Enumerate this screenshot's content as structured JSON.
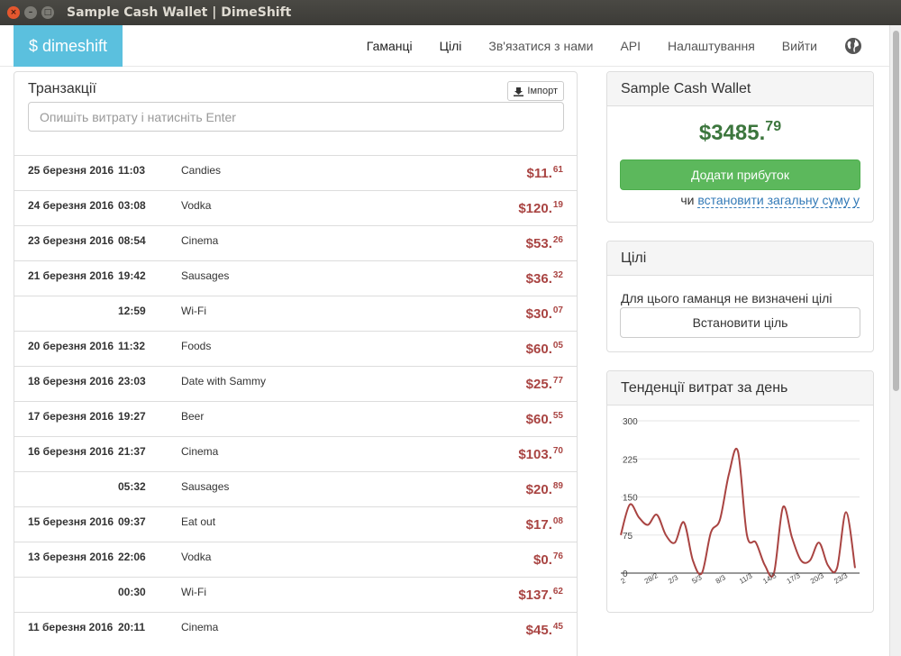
{
  "window": {
    "title": "Sample Cash Wallet | DimeShift"
  },
  "navbar": {
    "brand": "$ dimeshift",
    "links": [
      "Гаманці",
      "Цілі",
      "Зв'язатися з нами",
      "API",
      "Налаштування",
      "Вийти"
    ]
  },
  "transactions": {
    "heading": "Транзакції",
    "import_label": "Імпорт",
    "input_placeholder": "Опишіть витрату і натисніть Enter",
    "rows": [
      {
        "date": "25 березня 2016",
        "time": "11:03",
        "desc": "Candies",
        "amount": "$11.",
        "cents": "61"
      },
      {
        "date": "24 березня 2016",
        "time": "03:08",
        "desc": "Vodka",
        "amount": "$120.",
        "cents": "19"
      },
      {
        "date": "23 березня 2016",
        "time": "08:54",
        "desc": "Cinema",
        "amount": "$53.",
        "cents": "26"
      },
      {
        "date": "21 березня 2016",
        "time": "19:42",
        "desc": "Sausages",
        "amount": "$36.",
        "cents": "32"
      },
      {
        "date": "",
        "time": "12:59",
        "desc": "Wi-Fi",
        "amount": "$30.",
        "cents": "07"
      },
      {
        "date": "20 березня 2016",
        "time": "11:32",
        "desc": "Foods",
        "amount": "$60.",
        "cents": "05"
      },
      {
        "date": "18 березня 2016",
        "time": "23:03",
        "desc": "Date with Sammy",
        "amount": "$25.",
        "cents": "77"
      },
      {
        "date": "17 березня 2016",
        "time": "19:27",
        "desc": "Beer",
        "amount": "$60.",
        "cents": "55"
      },
      {
        "date": "16 березня 2016",
        "time": "21:37",
        "desc": "Cinema",
        "amount": "$103.",
        "cents": "70"
      },
      {
        "date": "",
        "time": "05:32",
        "desc": "Sausages",
        "amount": "$20.",
        "cents": "89"
      },
      {
        "date": "15 березня 2016",
        "time": "09:37",
        "desc": "Eat out",
        "amount": "$17.",
        "cents": "08"
      },
      {
        "date": "13 березня 2016",
        "time": "22:06",
        "desc": "Vodka",
        "amount": "$0.",
        "cents": "76"
      },
      {
        "date": "",
        "time": "00:30",
        "desc": "Wi-Fi",
        "amount": "$137.",
        "cents": "62"
      },
      {
        "date": "11 березня 2016",
        "time": "20:11",
        "desc": "Cinema",
        "amount": "$45.",
        "cents": "45"
      }
    ]
  },
  "wallet": {
    "title": "Sample Cash Wallet",
    "balance_main": "$3485.",
    "balance_cents": "79",
    "add_income_label": "Додати прибуток",
    "or_label": "чи",
    "set_total_label": "встановити загальну суму у"
  },
  "goals": {
    "title": "Цілі",
    "empty_text": "Для цього гаманця не визначені цілі",
    "set_goal_label": "Встановити ціль"
  },
  "trend": {
    "title": "Тенденції витрат за день"
  },
  "colors": {
    "brand": "#5bc0de",
    "expense": "#a94442",
    "balance": "#3c763d",
    "success": "#5cb85c",
    "link": "#337ab7",
    "trend_line": "#a94442"
  },
  "chart_data": {
    "type": "line",
    "title": "Тенденції витрат за день",
    "ylim": [
      0,
      300
    ],
    "y_ticks": [
      0,
      75,
      150,
      225,
      300
    ],
    "x_tick_labels": [
      "2",
      "28/2",
      "2/3",
      "5/3",
      "8/3",
      "11/3",
      "14/3",
      "17/3",
      "20/3",
      "23/3"
    ],
    "series": [
      {
        "values": [
          75,
          135,
          110,
          95,
          115,
          75,
          60,
          100,
          25,
          0,
          80,
          105,
          195,
          240,
          75,
          60,
          15,
          0,
          130,
          70,
          25,
          25,
          60,
          15,
          10,
          120,
          10
        ]
      }
    ]
  }
}
